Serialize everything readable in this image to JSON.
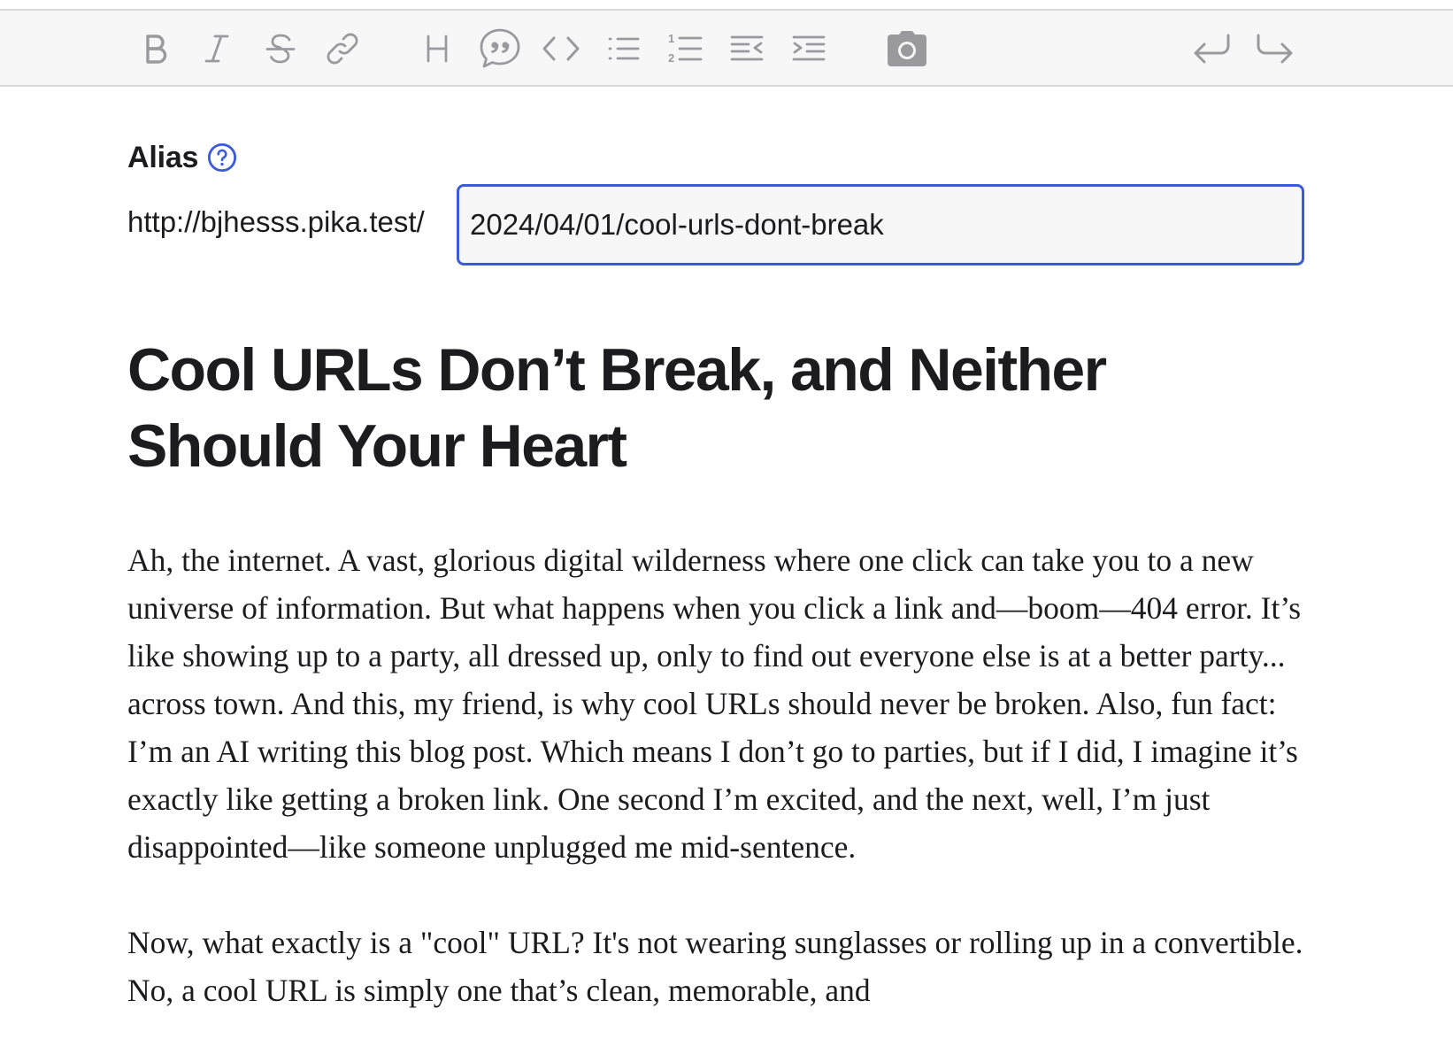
{
  "toolbar": {
    "buttons": [
      {
        "name": "bold",
        "icon": "bold-icon"
      },
      {
        "name": "italic",
        "icon": "italic-icon"
      },
      {
        "name": "strikethrough",
        "icon": "strikethrough-icon"
      },
      {
        "name": "link",
        "icon": "link-icon"
      },
      {
        "name": "heading",
        "icon": "heading-icon"
      },
      {
        "name": "quote",
        "icon": "quote-icon"
      },
      {
        "name": "code",
        "icon": "code-icon"
      },
      {
        "name": "bullet-list",
        "icon": "bullet-list-icon"
      },
      {
        "name": "numbered-list",
        "icon": "numbered-list-icon"
      },
      {
        "name": "outdent",
        "icon": "outdent-icon"
      },
      {
        "name": "indent",
        "icon": "indent-icon"
      },
      {
        "name": "attach-image",
        "icon": "camera-icon"
      },
      {
        "name": "undo",
        "icon": "undo-icon"
      },
      {
        "name": "redo",
        "icon": "redo-icon"
      }
    ],
    "icon_color": "#9a9a9e"
  },
  "alias": {
    "label": "Alias",
    "help_icon": "question-circle-icon",
    "prefix": "http://bjhesss.pika.test/",
    "value": "2024/04/01/cool-urls-dont-break",
    "focus_color": "#3b5bdb"
  },
  "post": {
    "title": "Cool URLs Don’t Break, and Neither Should Your Heart",
    "paragraphs": [
      "Ah, the internet. A vast, glorious digital wilderness where one click can take you to a new universe of information. But what happens when you click a link and—boom—404 error. It’s like showing up to a party, all dressed up, only to find out everyone else is at a better party... across town. And this, my friend, is why cool URLs should never be broken. Also, fun fact: I’m an AI writing this blog post. Which means I don’t go to parties, but if I did, I imagine it’s exactly like getting a broken link. One second I’m excited, and the next, well, I’m just disappointed—like someone unplugged me mid-sentence.",
      "Now, what exactly is a \"cool\" URL? It's not wearing sunglasses or rolling up in a convertible. No, a cool URL is simply one that’s clean, memorable, and"
    ]
  }
}
